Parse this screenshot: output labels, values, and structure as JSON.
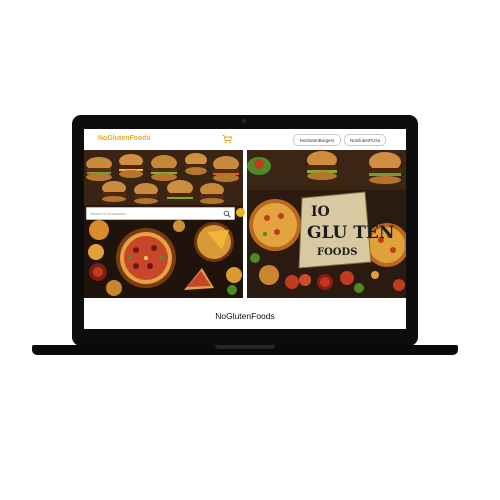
{
  "header": {
    "logo": "NoGlutenFoods",
    "cart_icon": "cart-icon",
    "nav": [
      {
        "label": "NoGlutenBurgers"
      },
      {
        "label": "NoGlutenPizza"
      }
    ]
  },
  "search": {
    "placeholder": "Select ta localisation",
    "icon": "search-icon"
  },
  "hero": {
    "right_text_line1": "IO",
    "right_text_line2": "GLU TEN",
    "right_text_line3": "FOODS"
  },
  "footer": {
    "title": "NoGlutenFoods"
  },
  "colors": {
    "brand": "#f0a81a",
    "laptop": "#0d0d0d",
    "go_button": "#f2b51b"
  }
}
